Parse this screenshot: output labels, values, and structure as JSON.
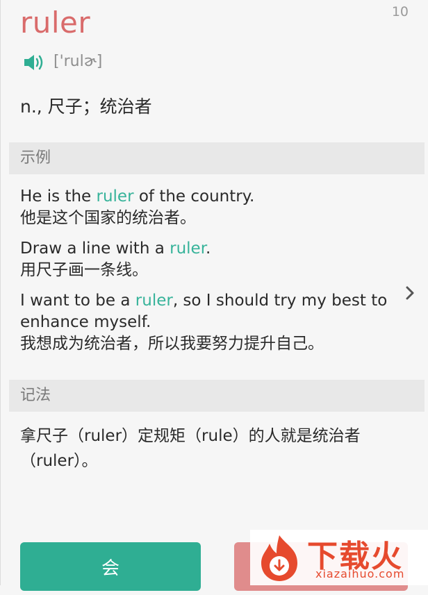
{
  "header": {
    "word": "ruler",
    "counter": "10",
    "phonetic": "['rulɚ]",
    "definition": "n., 尺子；统治者"
  },
  "examples_section": {
    "title": "示例",
    "items": [
      {
        "en_before": "He is the ",
        "en_highlight": "ruler",
        "en_after": " of the country.",
        "zh": "他是这个国家的统治者。"
      },
      {
        "en_before": "Draw a line with a ",
        "en_highlight": "ruler",
        "en_after": ".",
        "zh": "用尺子画一条线。"
      },
      {
        "en_before": "I want to be a ",
        "en_highlight": "ruler",
        "en_after": ", so I should try my best to",
        "en_line2": "enhance myself.",
        "zh": "我想成为统治者，所以我要努力提升自己。"
      }
    ]
  },
  "mnemonic_section": {
    "title": "记法",
    "text": "拿尺子（ruler）定规矩（rule）的人就是统治者（ruler）。"
  },
  "actions": {
    "know_label": "会"
  },
  "watermark": {
    "brand_cn": "下载火",
    "brand_url": "xiazaihuo.com"
  },
  "colors": {
    "word": "#d96b6b",
    "highlight": "#37b39a",
    "know_button": "#2fae93",
    "unknown_button": "#e08c8c",
    "watermark": "#e64a2e"
  },
  "icons": {
    "speaker": "speaker-icon",
    "next": "chevron-right-icon",
    "watermark_logo": "flame-logo"
  }
}
